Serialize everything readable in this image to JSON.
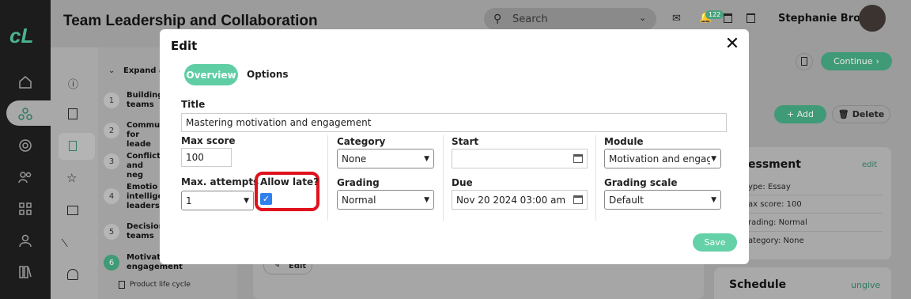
{
  "header": {
    "title": "Team Leadership and Collaboration",
    "search_placeholder": "Search",
    "notification_count": "122",
    "user_name": "Stephanie Brown"
  },
  "sidebar": {
    "expand_label": "Expand al",
    "steps": [
      {
        "num": "1",
        "label": "Building teams"
      },
      {
        "num": "2",
        "label": "Commu for leade"
      },
      {
        "num": "3",
        "label": "Conflict and neg"
      },
      {
        "num": "4",
        "label": "Emotio intellige leadersh"
      },
      {
        "num": "5",
        "label": "Decision teams"
      },
      {
        "num": "6",
        "label": "Motivati engagement"
      }
    ],
    "sub_item": "Product life cycle"
  },
  "main": {
    "continue_label": "Continue",
    "add_label": "Add",
    "delete_label": "Delete",
    "edit_label": "Edit"
  },
  "assessment_panel": {
    "title": "essment",
    "edit_link": "edit",
    "rows": [
      "ype: Essay",
      "ax score: 100",
      "rading: Normal",
      "ategory: None"
    ]
  },
  "schedule_panel": {
    "title": "Schedule",
    "link": "ungive"
  },
  "modal": {
    "title": "Edit",
    "tabs": {
      "overview": "Overview",
      "options": "Options"
    },
    "title_label": "Title",
    "title_value": "Mastering motivation and engagement",
    "max_score_label": "Max score",
    "max_score_value": "100",
    "max_attempts_label": "Max. attempts",
    "max_attempts_value": "1",
    "allow_late_label": "Allow late?",
    "allow_late_checked": true,
    "category_label": "Category",
    "category_value": "None",
    "grading_label": "Grading",
    "grading_value": "Normal",
    "start_label": "Start",
    "start_value": "",
    "due_label": "Due",
    "due_value": "Nov 20 2024 03:00 am",
    "module_label": "Module",
    "module_value": "Motivation and engage",
    "grading_scale_label": "Grading scale",
    "grading_scale_value": "Default",
    "save_label": "Save",
    "checkmark": "✓"
  },
  "colors": {
    "accent": "#5fcea5",
    "highlight": "#e0101c",
    "checkbox": "#2f80ed"
  }
}
